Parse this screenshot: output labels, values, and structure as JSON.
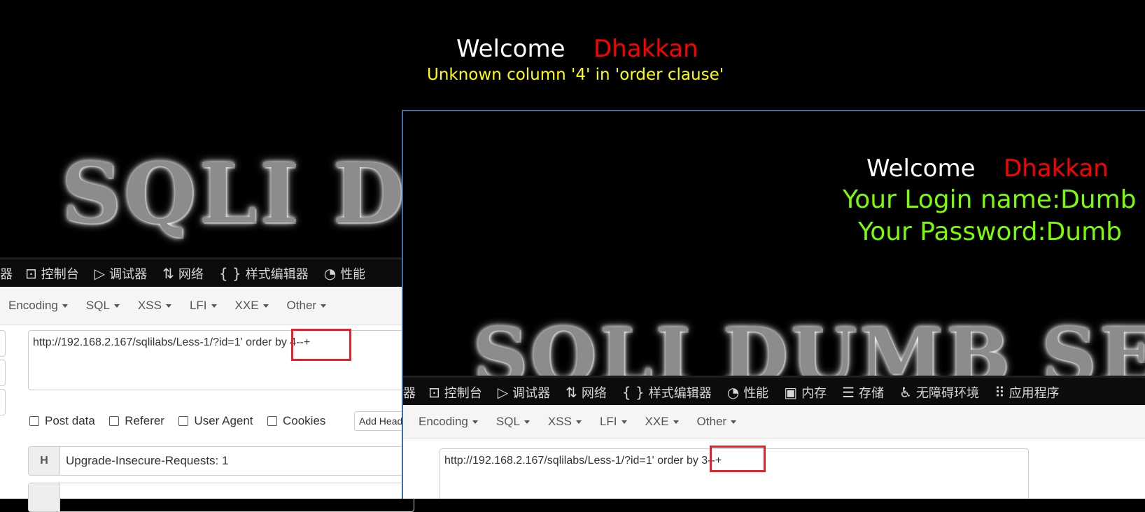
{
  "back_window": {
    "welcome": "Welcome",
    "user": "Dhakkan",
    "error": "Unknown column '4' in 'order clause'",
    "logo": "SQLI D",
    "devtools": {
      "truncated": "器",
      "tabs": [
        {
          "icon": "console-icon",
          "glyph": "⊡",
          "label": "控制台"
        },
        {
          "icon": "debugger-icon",
          "glyph": "▷",
          "label": "调试器"
        },
        {
          "icon": "network-icon",
          "glyph": "⇅",
          "label": "网络"
        },
        {
          "icon": "style-editor-icon",
          "glyph": "{ }",
          "label": "样式编辑器"
        },
        {
          "icon": "performance-icon",
          "glyph": "◔",
          "label": "性能"
        }
      ]
    },
    "hackbar": {
      "menu": [
        "Encoding",
        "SQL",
        "XSS",
        "LFI",
        "XXE",
        "Other"
      ],
      "url": "http://192.168.2.167/sqlilabs/Less-1/?id=1' order by 4--+",
      "checkboxes": [
        "Post data",
        "Referer",
        "User Agent",
        "Cookies"
      ],
      "add_header": "Add Head",
      "header_key": "H",
      "header_value": "Upgrade-Insecure-Requests: 1"
    }
  },
  "front_window": {
    "welcome": "Welcome",
    "user": "Dhakkan",
    "login_name": "Your Login name:Dumb",
    "password": "Your Password:Dumb",
    "logo": "SQLI DUMB SE",
    "devtools": {
      "truncated": "器",
      "tabs": [
        {
          "icon": "console-icon",
          "glyph": "⊡",
          "label": "控制台"
        },
        {
          "icon": "debugger-icon",
          "glyph": "▷",
          "label": "调试器"
        },
        {
          "icon": "network-icon",
          "glyph": "⇅",
          "label": "网络"
        },
        {
          "icon": "style-editor-icon",
          "glyph": "{ }",
          "label": "样式编辑器"
        },
        {
          "icon": "performance-icon",
          "glyph": "◔",
          "label": "性能"
        },
        {
          "icon": "memory-icon",
          "glyph": "▣",
          "label": "内存"
        },
        {
          "icon": "storage-icon",
          "glyph": "☰",
          "label": "存储"
        },
        {
          "icon": "accessibility-icon",
          "glyph": "♿",
          "label": "无障碍环境"
        },
        {
          "icon": "application-icon",
          "glyph": "⠿",
          "label": "应用程序"
        }
      ]
    },
    "hackbar": {
      "menu": [
        "Encoding",
        "SQL",
        "XSS",
        "LFI",
        "XXE",
        "Other"
      ],
      "url": "http://192.168.2.167/sqlilabs/Less-1/?id=1' order by 3--+"
    }
  },
  "colors": {
    "welcome": "#ffffff",
    "user": "#ff0000",
    "error": "#ffff00",
    "login": "#7cfc00",
    "highlight": "#e8202a"
  }
}
